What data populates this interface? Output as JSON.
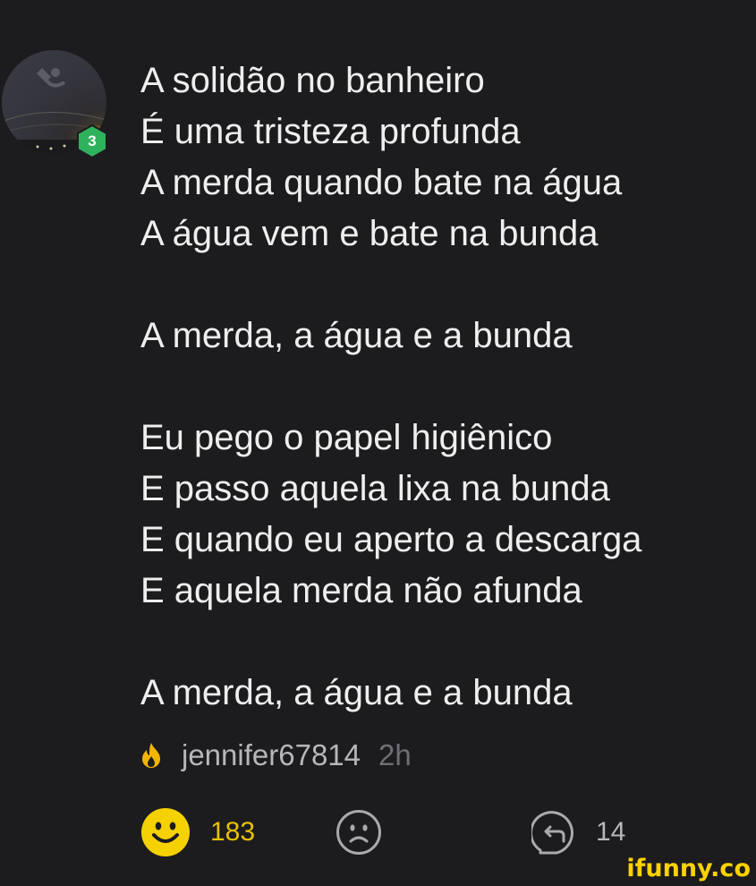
{
  "user": {
    "level": "3",
    "username": "jennifer67814",
    "time_ago": "2h"
  },
  "comment": {
    "lines": [
      "A solidão no banheiro",
      "É uma tristeza profunda",
      "A merda quando bate na água",
      "A água vem e bate na bunda",
      "",
      "A merda, a água e a bunda",
      "",
      "Eu pego o papel higiênico",
      "E passo aquela lixa na bunda",
      "E quando eu aperto a descarga",
      "E aquela merda não afunda",
      "",
      "A merda, a água e a bunda"
    ]
  },
  "actions": {
    "smile_count": "183",
    "reply_count": "14"
  },
  "watermark": "ifunny.co",
  "colors": {
    "background": "#1c1c1f",
    "smile_yellow": "#f5d100",
    "badge_green": "#2fb25c",
    "fire_orange": "#f2b400"
  },
  "icons": {
    "fire": "fire-icon",
    "smile": "smile-icon",
    "unsmile": "unsmile-icon",
    "reply": "reply-icon"
  }
}
